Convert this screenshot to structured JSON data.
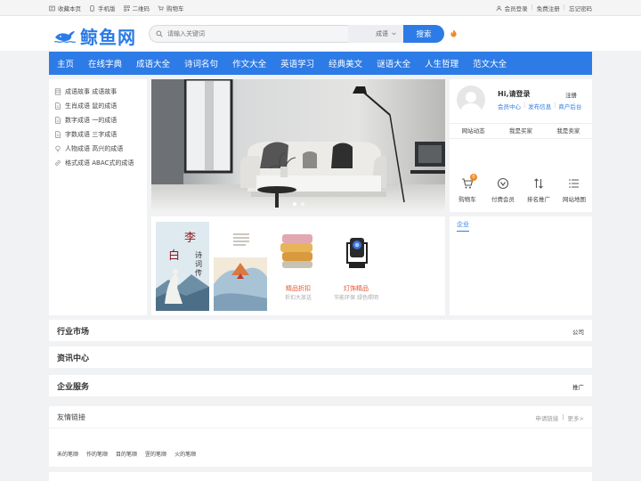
{
  "topbar": {
    "left": [
      {
        "label": "收藏本页",
        "icon": "bookmark-icon"
      },
      {
        "label": "手机版",
        "icon": "mobile-icon"
      },
      {
        "label": "二维码",
        "icon": "qrcode-icon"
      },
      {
        "label": "购物车",
        "icon": "cart-icon"
      }
    ],
    "login": "会员登录",
    "register": "免费注册",
    "forgot": "忘记密码",
    "sep": "|"
  },
  "logo": {
    "text": "鲸鱼网",
    "brand_color": "#2d7be6"
  },
  "search": {
    "placeholder": "请输入关键词",
    "category": "成语",
    "button": "搜索"
  },
  "nav": [
    "主页",
    "在线字典",
    "成语大全",
    "诗词名句",
    "作文大全",
    "英语学习",
    "经典美文",
    "谜语大全",
    "人生哲理",
    "范文大全"
  ],
  "leftmenu": [
    {
      "label": "成语故事 成语故事",
      "icon": "book-icon"
    },
    {
      "label": "生肖成语 鼠的成语",
      "icon": "document-icon"
    },
    {
      "label": "数字成语 一的成语",
      "icon": "document-icon"
    },
    {
      "label": "字数成语 三字成语",
      "icon": "document-icon"
    },
    {
      "label": "人物成语 高兴的成语",
      "icon": "lightbulb-icon"
    },
    {
      "label": "格式成语 ABAC式的成语",
      "icon": "link-icon"
    }
  ],
  "products": [
    {
      "caption": "",
      "sub": ""
    },
    {
      "caption": "",
      "sub": ""
    },
    {
      "caption": "精品折扣",
      "sub": "折扣大放送"
    },
    {
      "caption": "灯饰精品",
      "sub": "节能环保 绿色照明"
    }
  ],
  "user": {
    "greeting": "Hi,请登录",
    "register": "注册",
    "links": [
      "会员中心",
      "发布信息",
      "商户后台"
    ],
    "tabs": [
      "网站动态",
      "我是买家",
      "我是卖家"
    ],
    "quick": [
      {
        "label": "购物车",
        "icon": "cart-icon",
        "badge": "0"
      },
      {
        "label": "付费会员",
        "icon": "vip-icon"
      },
      {
        "label": "排名推广",
        "icon": "sort-icon"
      },
      {
        "label": "网站地图",
        "icon": "list-icon"
      }
    ]
  },
  "qiye_tab": "企业",
  "sections": [
    {
      "title": "行业市场",
      "right": "公司"
    },
    {
      "title": "资讯中心",
      "right": ""
    },
    {
      "title": "企业服务",
      "right": "推广"
    }
  ],
  "friend": {
    "title": "友情链接",
    "apply": "申请链接",
    "sep": "|",
    "more": "更多>",
    "links": [
      "禾的笔顺",
      "作的笔顺",
      "目的笔顺",
      "罡的笔顺",
      "火的笔顺"
    ]
  }
}
